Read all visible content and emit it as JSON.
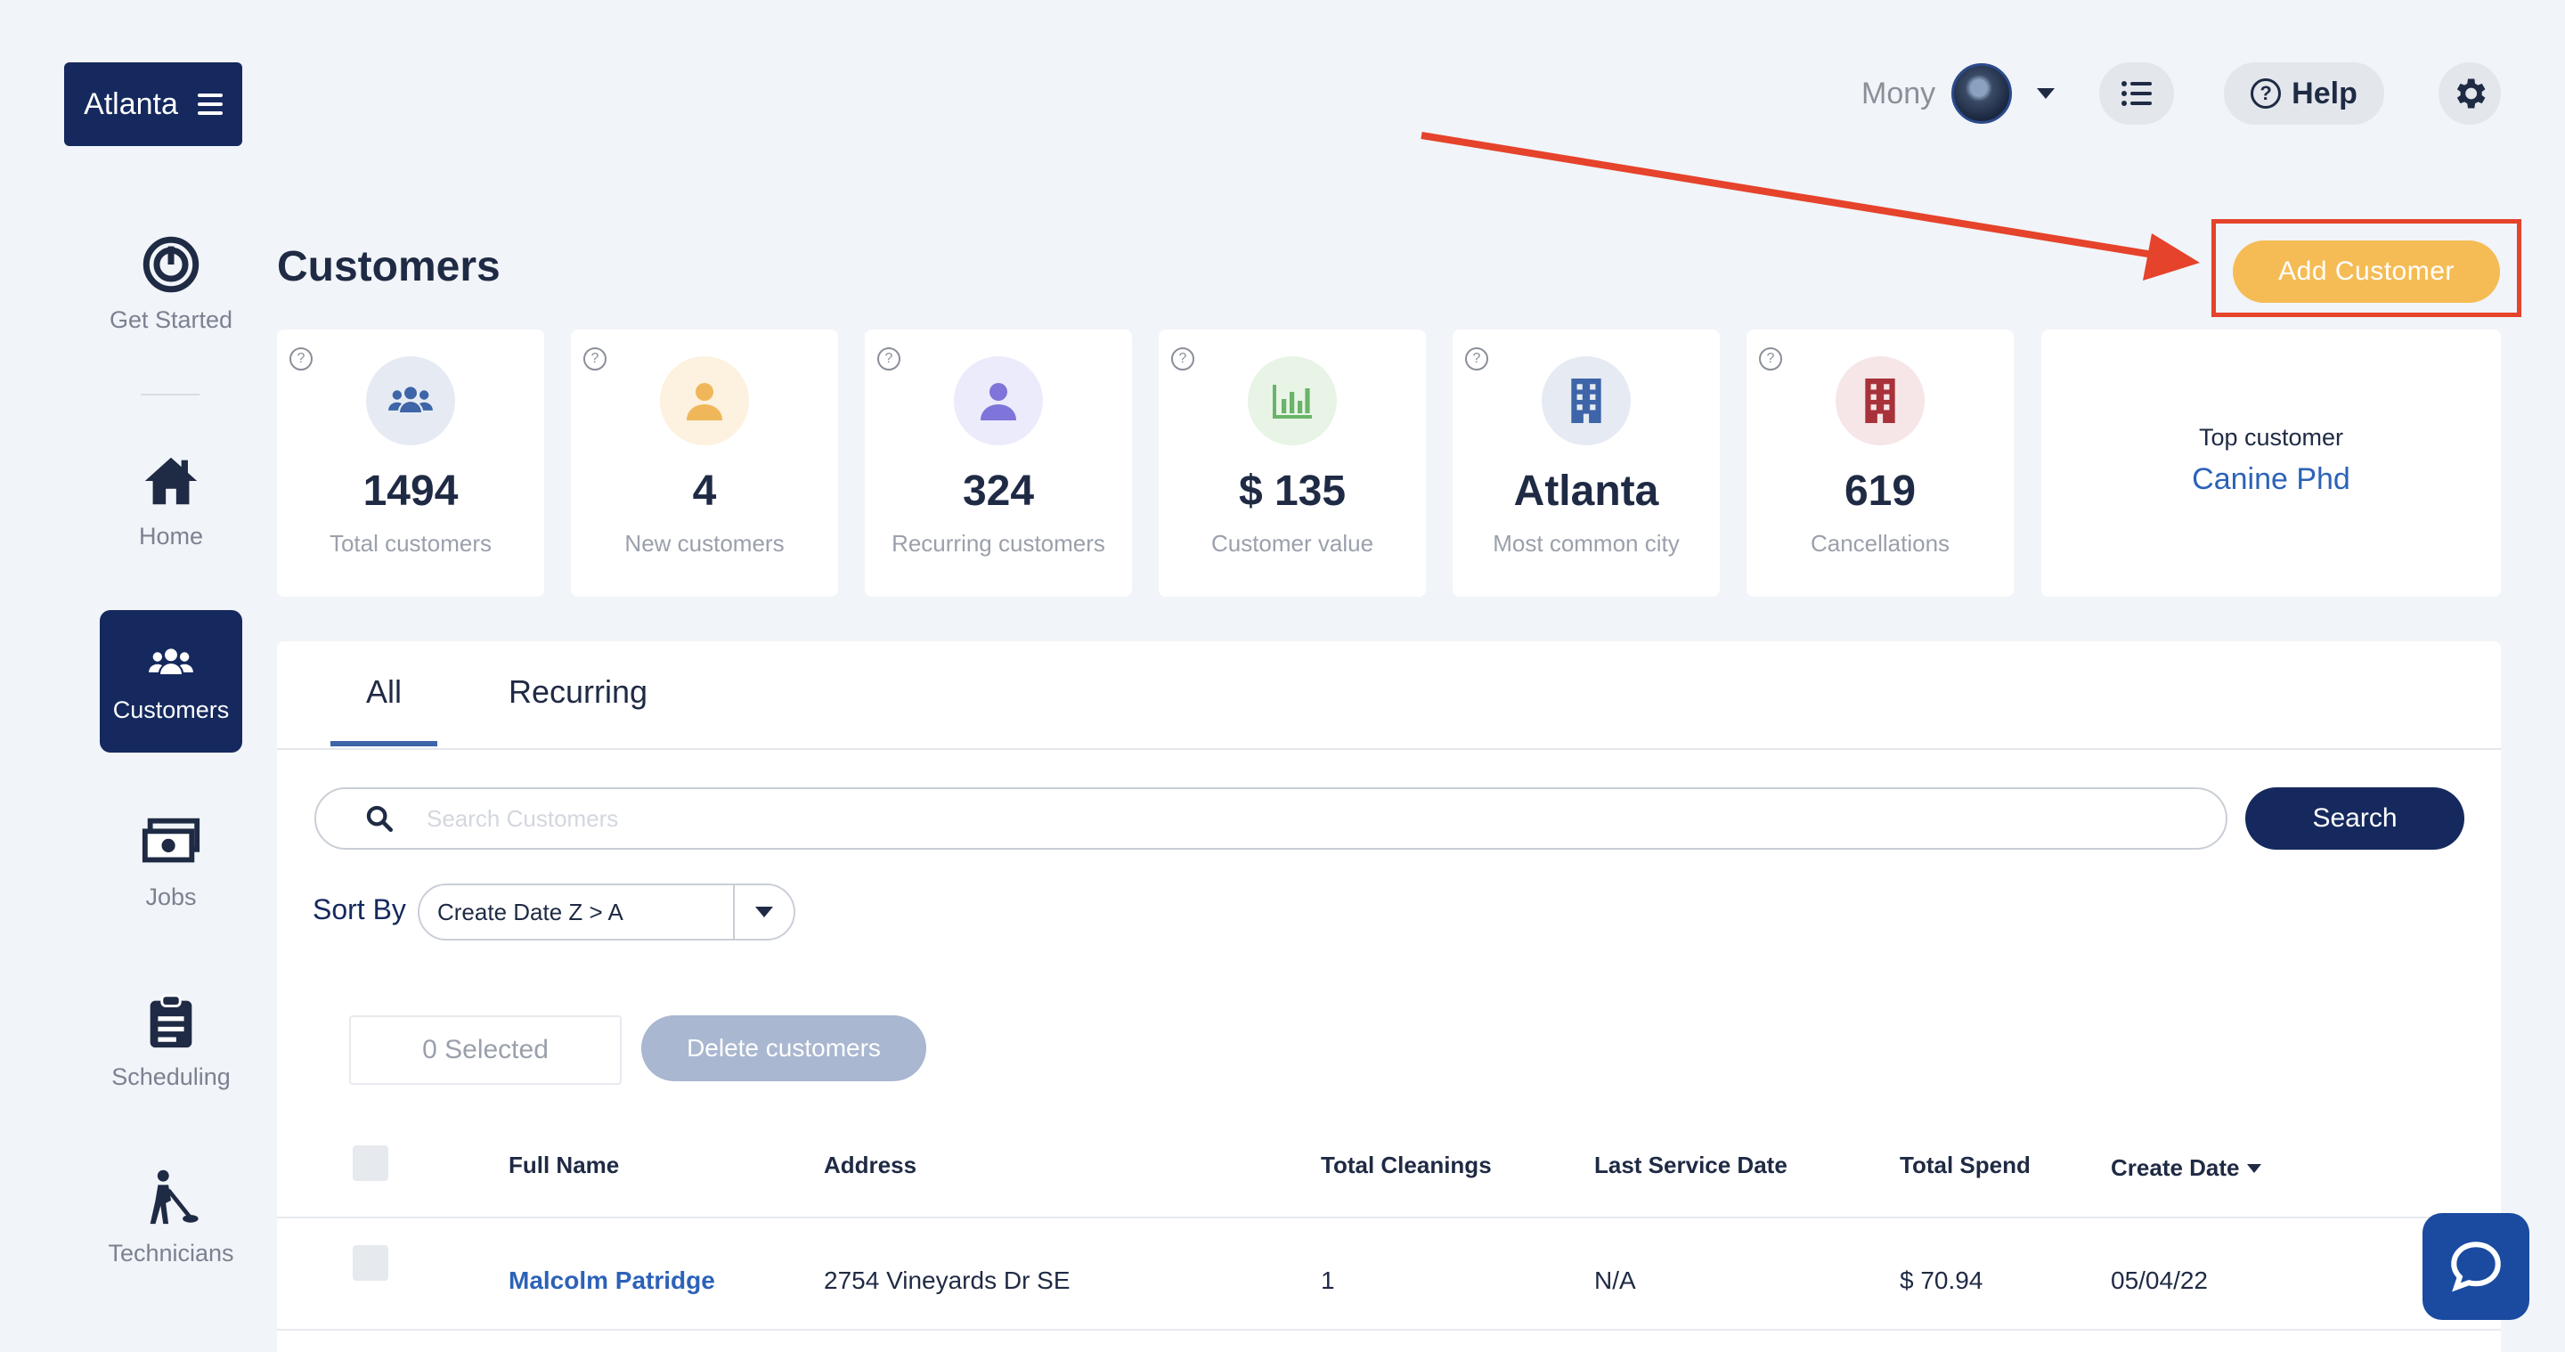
{
  "brand": {
    "label": "Atlanta"
  },
  "header": {
    "user_name": "Mony",
    "help_label": "Help"
  },
  "sidebar": {
    "items": [
      {
        "label": "Get Started"
      },
      {
        "label": "Home"
      },
      {
        "label": "Customers"
      },
      {
        "label": "Jobs"
      },
      {
        "label": "Scheduling"
      },
      {
        "label": "Technicians"
      }
    ]
  },
  "page": {
    "title": "Customers",
    "add_button": "Add Customer"
  },
  "stats": [
    {
      "value": "1494",
      "label": "Total customers",
      "icon": "users-icon",
      "color": "#3d65a8"
    },
    {
      "value": "4",
      "label": "New customers",
      "icon": "user-icon",
      "color": "#f0b75a"
    },
    {
      "value": "324",
      "label": "Recurring customers",
      "icon": "user-icon",
      "color": "#7f74d9"
    },
    {
      "value": "$ 135",
      "label": "Customer value",
      "icon": "chart-icon",
      "color": "#6ab36a"
    },
    {
      "value": "Atlanta",
      "label": "Most common city",
      "icon": "building-icon",
      "color": "#3d65a8"
    },
    {
      "value": "619",
      "label": "Cancellations",
      "icon": "building-icon",
      "color": "#a8323a"
    }
  ],
  "top_customer": {
    "label": "Top customer",
    "name": "Canine Phd"
  },
  "tabs": [
    {
      "label": "All"
    },
    {
      "label": "Recurring"
    }
  ],
  "search": {
    "placeholder": "Search Customers",
    "button": "Search"
  },
  "sort": {
    "label": "Sort By",
    "value": "Create Date Z > A"
  },
  "bulk": {
    "selected": "0 Selected",
    "delete": "Delete customers"
  },
  "table": {
    "headers": [
      "Full Name",
      "Address",
      "Total Cleanings",
      "Last Service Date",
      "Total Spend",
      "Create Date"
    ],
    "rows": [
      {
        "name": "Malcolm Patridge",
        "address": "2754 Vineyards Dr SE",
        "cleanings": "1",
        "last_service": "N/A",
        "spend": "$ 70.94",
        "created": "05/04/22"
      }
    ]
  },
  "colors": {
    "navy": "#15295e",
    "accent": "#f5bc55",
    "annotation": "#e5432b"
  }
}
